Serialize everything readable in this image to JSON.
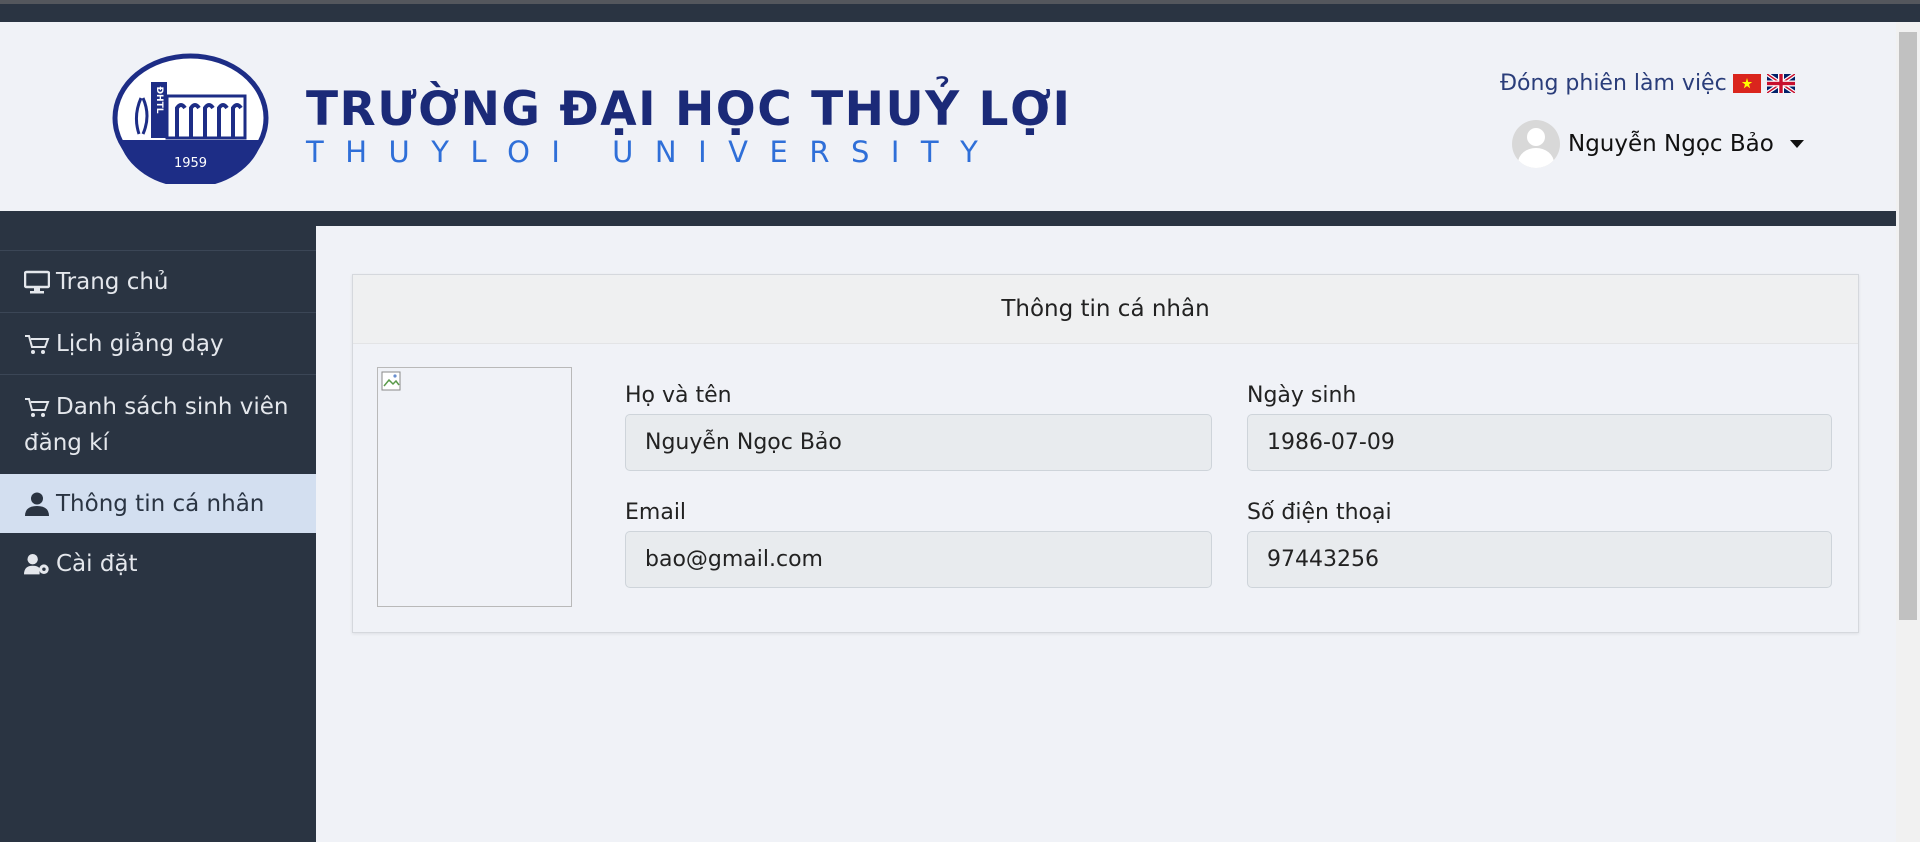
{
  "header": {
    "brand_vn": "TRƯỜNG ĐẠI HỌC THUỶ LỢI",
    "brand_en": "THUYLOI UNIVERSITY",
    "logo_text": {
      "left": "ĐHTL",
      "year": "1959"
    },
    "logout_label": "Đóng phiên làm việc",
    "flags": [
      "vn-flag-icon",
      "uk-flag-icon"
    ],
    "user_name": "Nguyễn Ngọc Bảo"
  },
  "sidebar": {
    "items": [
      {
        "label": "Trang chủ",
        "icon": "monitor-icon"
      },
      {
        "label": "Lịch giảng dạy",
        "icon": "cart-icon"
      },
      {
        "label": "Danh sách sinh viên",
        "label2": "đăng kí",
        "icon": "cart-icon"
      },
      {
        "label": "Thông tin cá nhân",
        "icon": "user-icon",
        "active": true
      },
      {
        "label": "Cài đặt",
        "icon": "user-gear-icon"
      }
    ]
  },
  "profile": {
    "title": "Thông tin cá nhân",
    "fields": {
      "fullname": {
        "label": "Họ và tên",
        "value": "Nguyễn Ngọc Bảo"
      },
      "dob": {
        "label": "Ngày sinh",
        "value": "1986-07-09"
      },
      "email": {
        "label": "Email",
        "value": "bao@gmail.com"
      },
      "phone": {
        "label": "Số điện thoại",
        "value": "97443256"
      }
    }
  },
  "colors": {
    "sidebar_bg": "#2a3442",
    "active_item_bg": "#d3dff0",
    "brand_dark_blue": "#1b2a78",
    "brand_light_blue": "#2f6fd8"
  }
}
